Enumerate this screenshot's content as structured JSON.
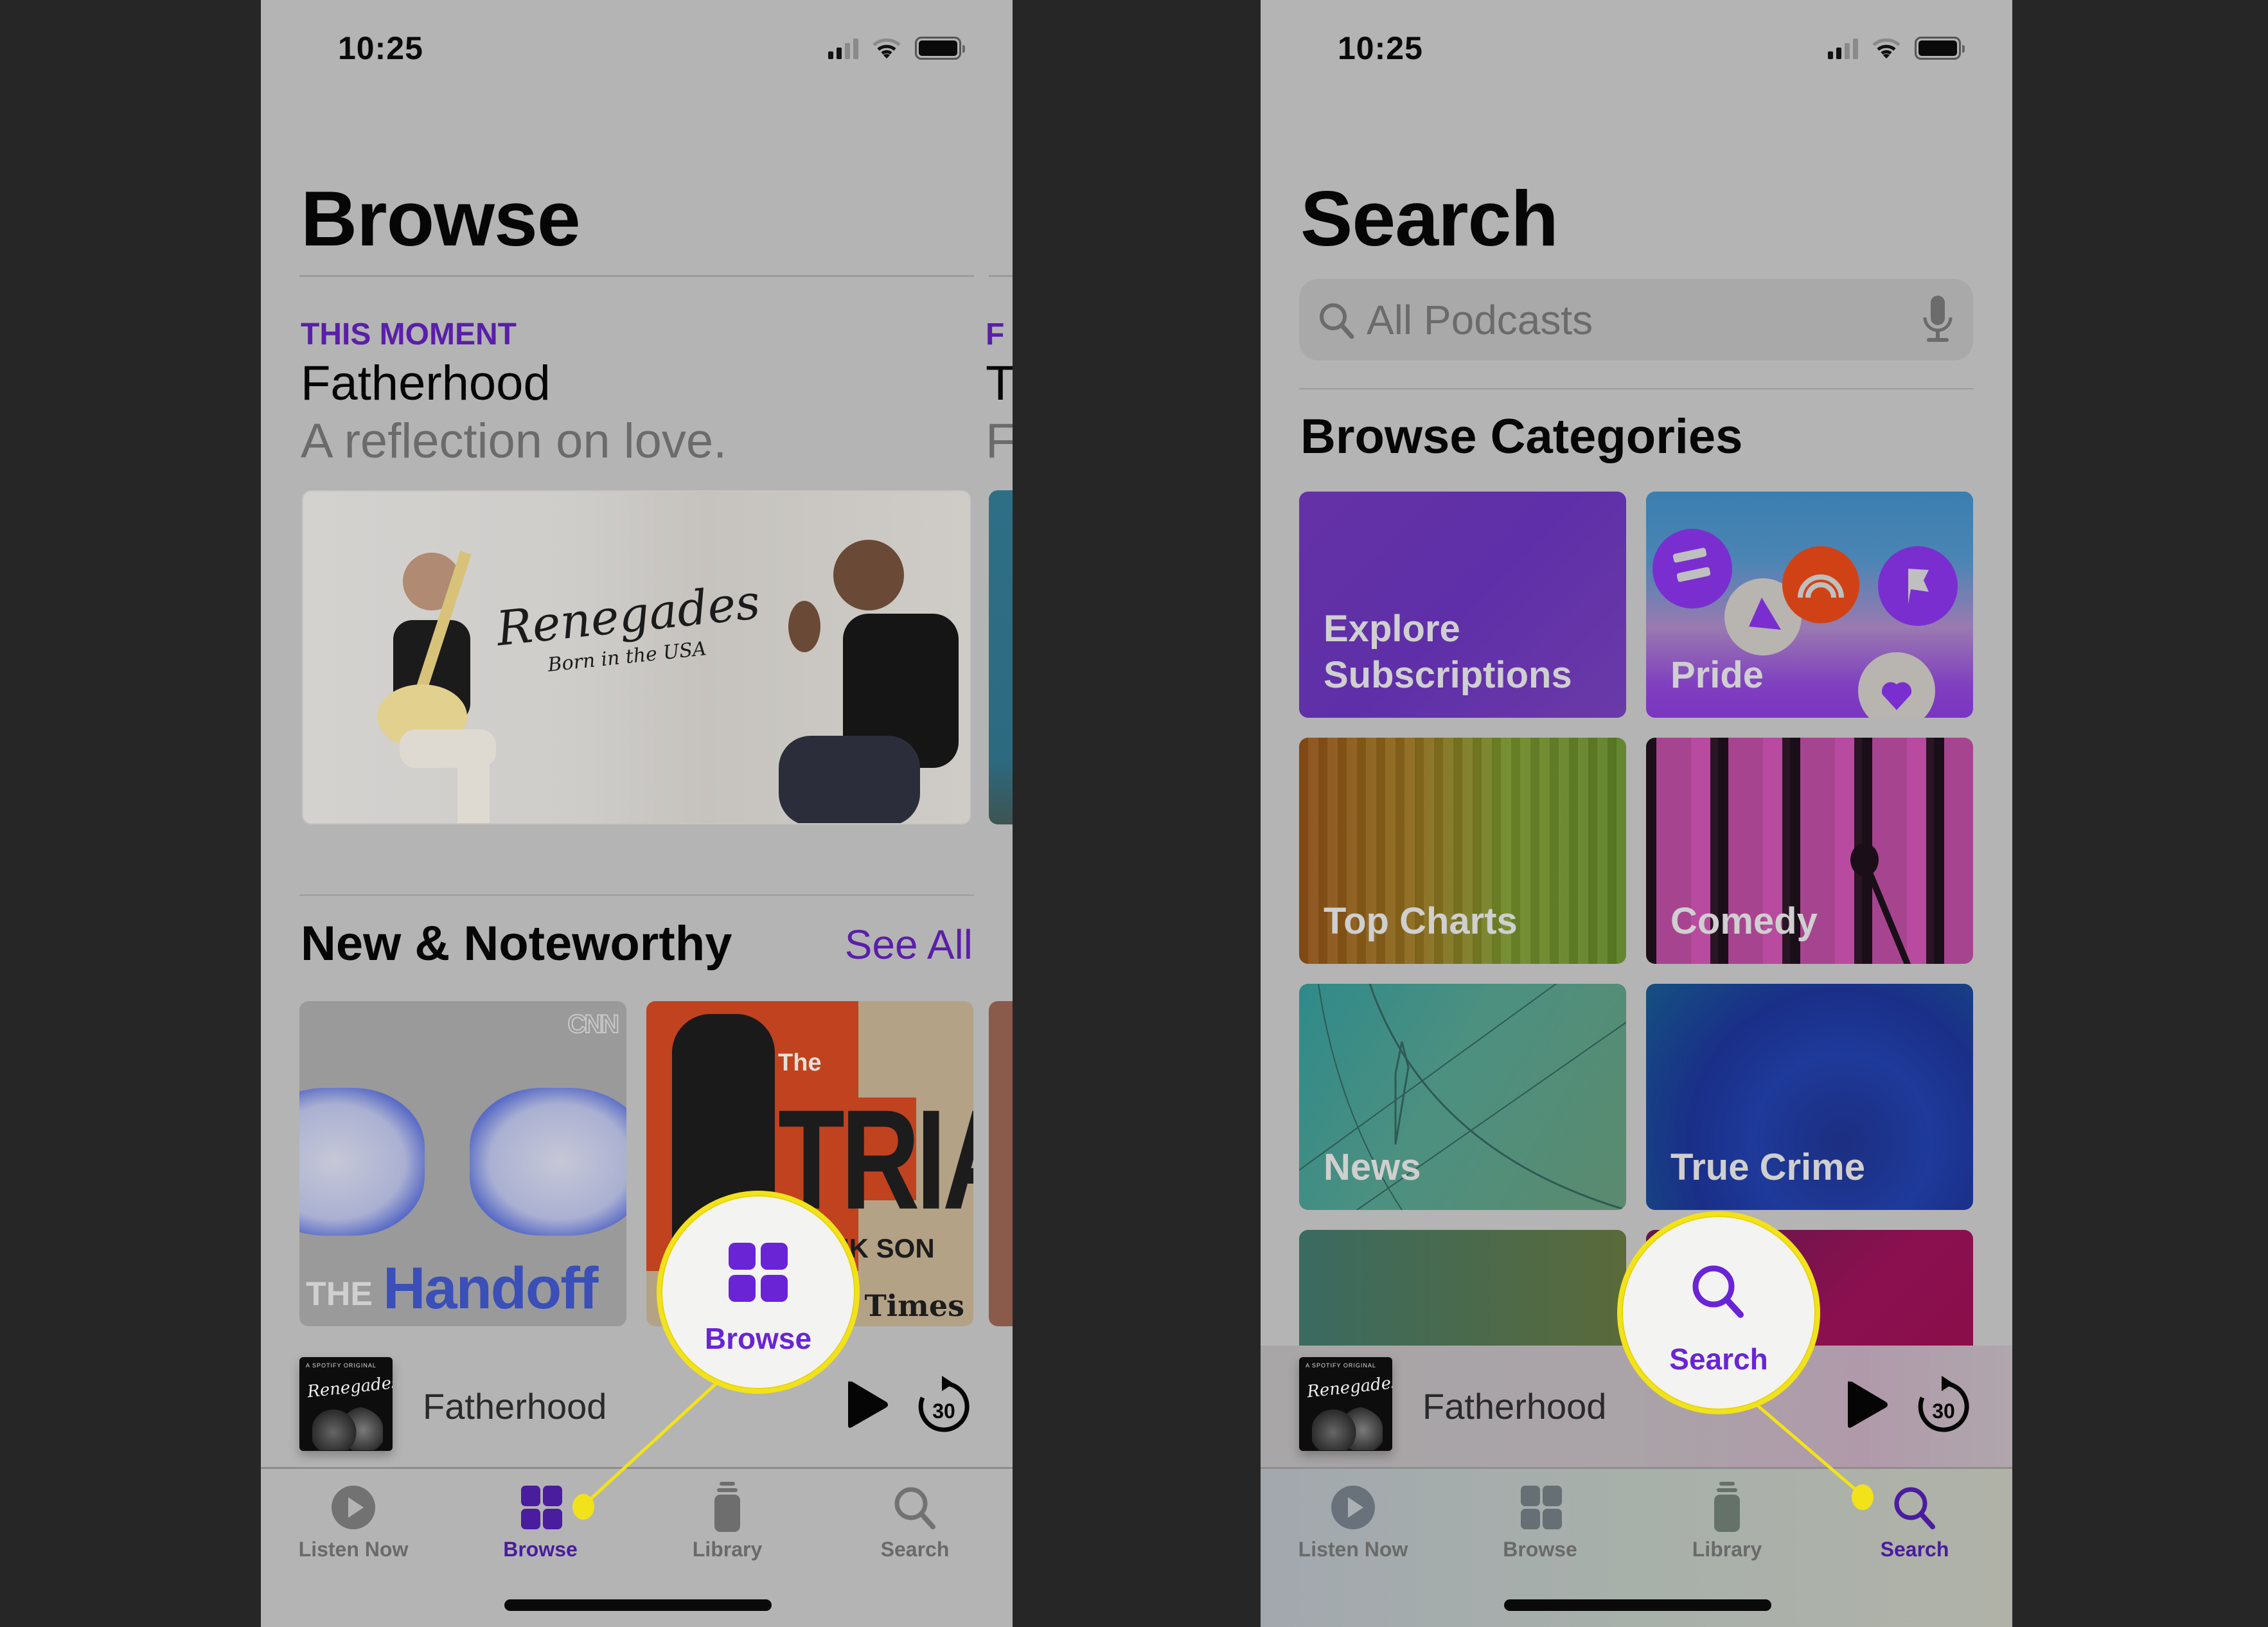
{
  "colors": {
    "accent": "#5a1fa8",
    "callout_yellow": "#f2e21a",
    "backdrop": "#262626"
  },
  "left_phone": {
    "status": {
      "time": "10:25",
      "icons": [
        "cellular-signal-icon",
        "wifi-icon",
        "battery-icon"
      ]
    },
    "page_title": "Browse",
    "featured": [
      {
        "eyebrow": "THIS MOMENT",
        "title": "Fatherhood",
        "subtitle": "A reflection on love.",
        "artwork_title": "Renegades",
        "artwork_subtitle": "Born in the USA"
      },
      {
        "eyebrow": "F",
        "title": "T",
        "subtitle": "F"
      }
    ],
    "section": {
      "title": "New & Noteworthy",
      "see_all": "See All",
      "cards": [
        {
          "brand": "CNN",
          "title_prefix": "THE",
          "title": "Handoff"
        },
        {
          "title_prefix": "The",
          "title": "TRIALS",
          "subtitle_fragment": "ANK SON",
          "publisher": "LA Times"
        },
        {
          "title": ""
        }
      ]
    },
    "mini_player": {
      "artwork_label": "A SPOTIFY ORIGINAL",
      "artwork_title": "Renegades",
      "title": "Fatherhood",
      "skip_seconds": "30"
    },
    "tabs": [
      {
        "label": "Listen Now",
        "icon": "play-circle-icon",
        "active": false
      },
      {
        "label": "Browse",
        "icon": "grid-icon",
        "active": true
      },
      {
        "label": "Library",
        "icon": "library-stack-icon",
        "active": false
      },
      {
        "label": "Search",
        "icon": "magnifier-icon",
        "active": false
      }
    ],
    "callout": {
      "label": "Browse",
      "icon": "grid-icon"
    }
  },
  "right_phone": {
    "status": {
      "time": "10:25",
      "icons": [
        "cellular-signal-icon",
        "wifi-icon",
        "battery-icon"
      ]
    },
    "page_title": "Search",
    "search": {
      "placeholder": "All Podcasts",
      "value": ""
    },
    "categories_title": "Browse Categories",
    "categories": [
      {
        "label": "Explore Subscriptions"
      },
      {
        "label": "Pride"
      },
      {
        "label": "Top Charts"
      },
      {
        "label": "Comedy"
      },
      {
        "label": "News"
      },
      {
        "label": "True Crime"
      },
      {
        "label": ""
      },
      {
        "label": ""
      }
    ],
    "mini_player": {
      "artwork_label": "A SPOTIFY ORIGINAL",
      "artwork_title": "Renegades",
      "title": "Fatherhood",
      "skip_seconds": "30"
    },
    "tabs": [
      {
        "label": "Listen Now",
        "icon": "play-circle-icon",
        "active": false
      },
      {
        "label": "Browse",
        "icon": "grid-icon",
        "active": false
      },
      {
        "label": "Library",
        "icon": "library-stack-icon",
        "active": false
      },
      {
        "label": "Search",
        "icon": "magnifier-icon",
        "active": true
      }
    ],
    "callout": {
      "label": "Search",
      "icon": "magnifier-icon"
    }
  }
}
